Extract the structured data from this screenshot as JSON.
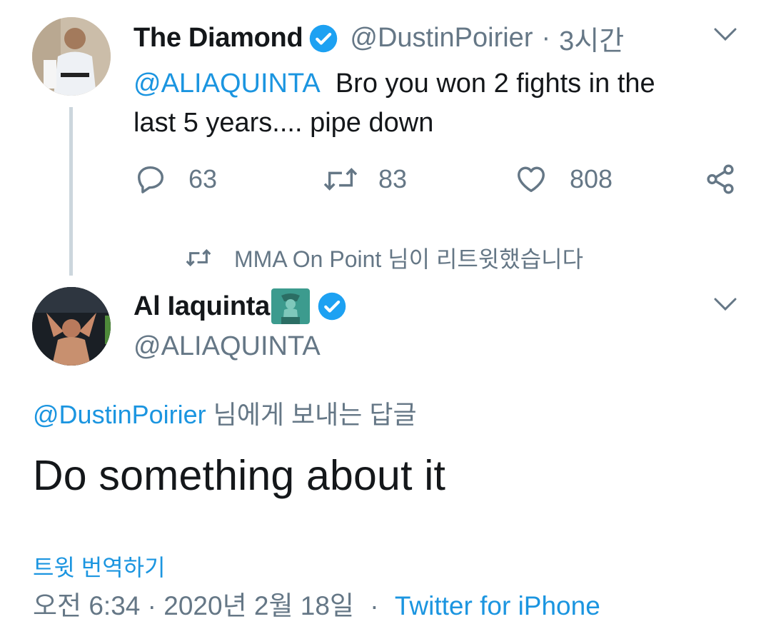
{
  "tweet1": {
    "display_name": "The Diamond",
    "handle": "@DustinPoirier",
    "separator": "·",
    "time": "3시간",
    "mention": "@ALIAQUINTA",
    "text_line1": "Bro you won 2 fights in the",
    "text_line2": "last 5 years.... pipe down",
    "replies": "63",
    "retweets": "83",
    "likes": "808"
  },
  "retweet_notice": "MMA On Point 님이 리트윗했습니다",
  "tweet2": {
    "display_name": "Al Iaquinta",
    "emoji": "🗽",
    "handle": "@ALIAQUINTA",
    "reply_to_handle": "@DustinPoirier",
    "reply_to_suffix": " 님에게 보내는 답글",
    "text": "Do something about it",
    "translate": "트윗 번역하기",
    "timestamp": "오전 6:34 · 2020년 2월 18일",
    "dot": "·",
    "client": "Twitter for iPhone"
  },
  "icons": {
    "verified": "verified-badge-icon",
    "reply": "reply-icon",
    "retweet": "retweet-icon",
    "like": "heart-icon",
    "share": "share-icon",
    "chevron": "chevron-down-icon"
  },
  "colors": {
    "link": "#1b95e0",
    "secondary": "#657786",
    "thread_line": "#ccd6dd"
  }
}
